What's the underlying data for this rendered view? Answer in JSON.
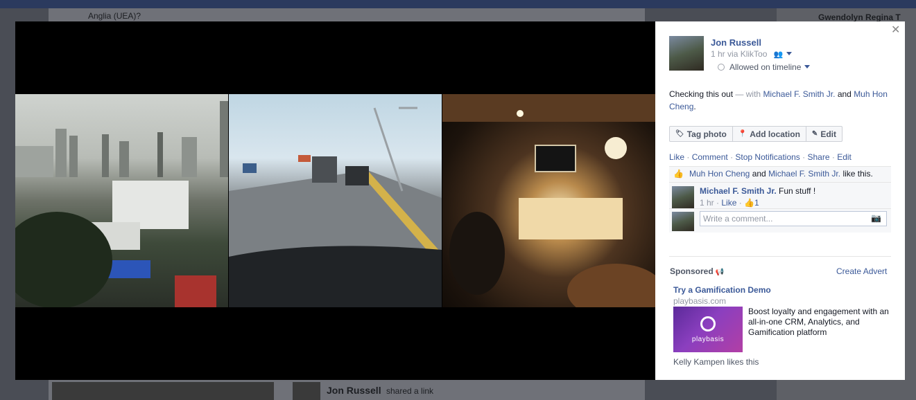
{
  "background": {
    "top_text": "Anglia (UEA)?",
    "right_name": "Gwendolyn Regina T",
    "bottom_author": "Jon Russell",
    "bottom_action": "shared a link"
  },
  "post": {
    "author": "Jon Russell",
    "time": "1 hr",
    "via": "via KlikToo",
    "timeline_status": "Allowed on timeline",
    "caption_text": "Checking this out",
    "caption_with": "— with",
    "tagged_1": "Michael F. Smith Jr.",
    "caption_and": "and",
    "tagged_2": "Muh Hon Cheng",
    "caption_end": "."
  },
  "buttons": {
    "tag_photo": "Tag photo",
    "add_location": "Add location",
    "edit": "Edit"
  },
  "actions": {
    "like": "Like",
    "comment": "Comment",
    "stop_notifications": "Stop Notifications",
    "share": "Share",
    "edit": "Edit",
    "separator": "·"
  },
  "likes": {
    "person_1": "Muh Hon Cheng",
    "and": "and",
    "person_2": "Michael F. Smith Jr.",
    "suffix": "like this."
  },
  "comment": {
    "author": "Michael F. Smith Jr.",
    "text": "Fun stuff !",
    "time": "1 hr",
    "like": "Like",
    "like_count": "1"
  },
  "write_comment": {
    "placeholder": "Write a comment..."
  },
  "sponsored": {
    "label": "Sponsored",
    "create_advert": "Create Advert",
    "ad_title": "Try a Gamification Demo",
    "ad_domain": "playbasis.com",
    "ad_brand": "playbasis",
    "ad_description": "Boost loyalty and engagement with an all-in-one CRM, Analytics, and Gamification platform",
    "social": "Kelly Kampen likes this"
  },
  "icons": {
    "close": "close-icon",
    "friends": "friends-icon",
    "tag": "tag-icon",
    "location": "location-pin-icon",
    "edit": "pencil-icon",
    "like": "thumbs-up-icon",
    "camera": "camera-icon",
    "megaphone": "megaphone-icon"
  },
  "colors": {
    "link": "#3b5998",
    "muted": "#9197a3",
    "stage": "#000000",
    "ufi_background": "#f6f7f9"
  }
}
